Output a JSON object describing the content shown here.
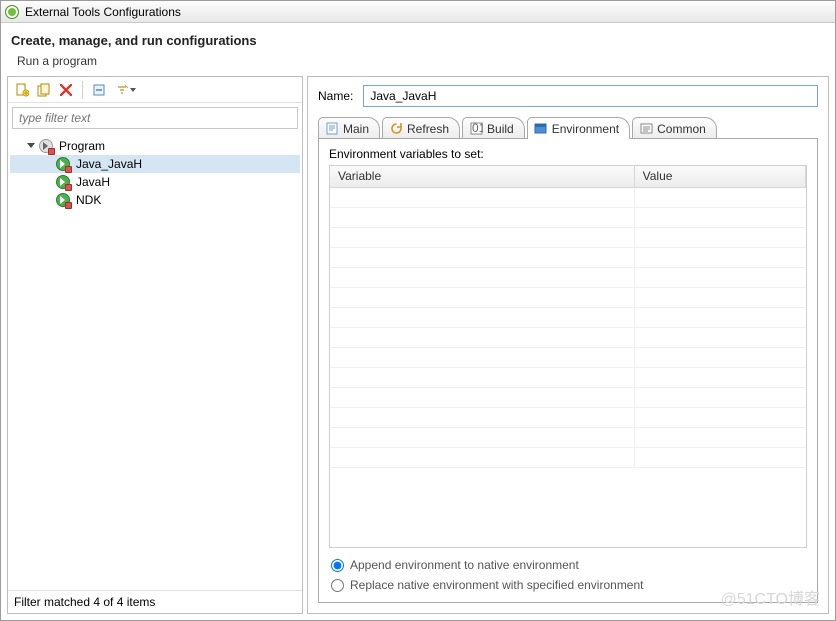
{
  "window_title": "External Tools Configurations",
  "header": {
    "title": "Create, manage, and run configurations",
    "subtitle": "Run a program"
  },
  "left": {
    "filter_placeholder": "type filter text",
    "tree": {
      "root_label": "Program",
      "items": [
        {
          "label": "Java_JavaH",
          "selected": true
        },
        {
          "label": "JavaH",
          "selected": false
        },
        {
          "label": "NDK",
          "selected": false
        }
      ]
    },
    "status": "Filter matched 4 of 4 items",
    "toolbar": {
      "new": "new-config",
      "duplicate": "duplicate-config",
      "delete": "delete-config",
      "collapse": "collapse-all",
      "filter": "filter-menu"
    }
  },
  "right": {
    "name_label": "Name:",
    "name_value": "Java_JavaH",
    "tabs": [
      {
        "id": "main",
        "label": "Main"
      },
      {
        "id": "refresh",
        "label": "Refresh"
      },
      {
        "id": "build",
        "label": "Build"
      },
      {
        "id": "environment",
        "label": "Environment",
        "active": true
      },
      {
        "id": "common",
        "label": "Common"
      }
    ],
    "env_section_label": "Environment variables to set:",
    "columns": {
      "variable": "Variable",
      "value": "Value"
    },
    "rows": [],
    "empty_row_count": 14,
    "radios": {
      "append": "Append environment to native environment",
      "replace": "Replace native environment with specified environment",
      "selected": "append"
    }
  },
  "watermark": "@51CTO博客"
}
